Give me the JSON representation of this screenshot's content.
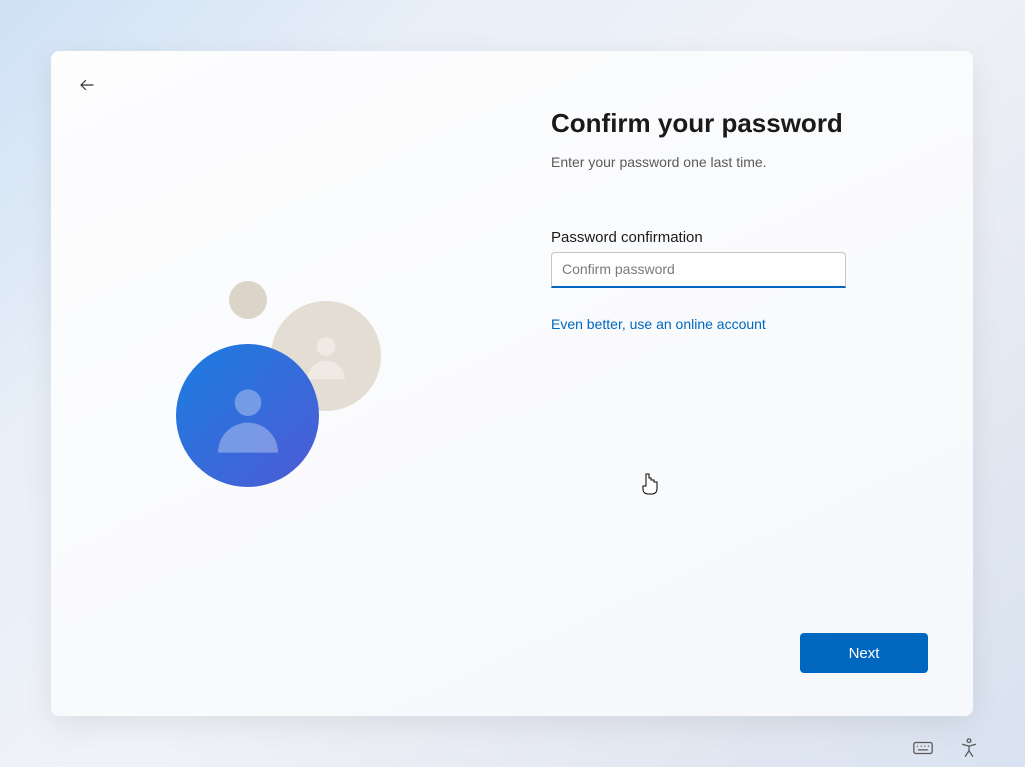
{
  "heading": {
    "title": "Confirm your password",
    "subtitle": "Enter your password one last time."
  },
  "form": {
    "label": "Password confirmation",
    "placeholder": "Confirm password",
    "value": ""
  },
  "link": {
    "text": "Even better, use an online account"
  },
  "buttons": {
    "next": "Next"
  }
}
